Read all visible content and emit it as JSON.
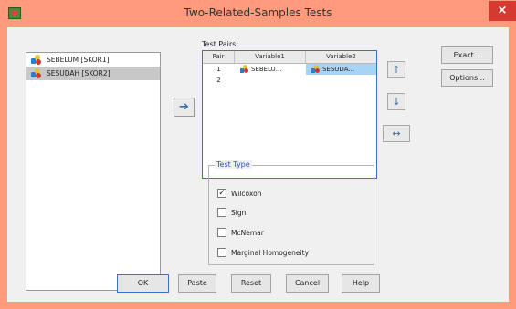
{
  "window": {
    "title": "Two-Related-Samples Tests",
    "close_glyph": "×",
    "icon": "spss-dialog-icon"
  },
  "variables": [
    {
      "label": "SEBELUM [SKOR1]",
      "icon": "scale-variable-icon",
      "selected": false
    },
    {
      "label": "SESUDAH [SKOR2]",
      "icon": "scale-variable-icon",
      "selected": true
    }
  ],
  "move_button": {
    "glyph": "➔",
    "icon": "arrow-right-icon"
  },
  "test_pairs": {
    "label": "Test Pairs:",
    "columns": [
      "Pair",
      "Variable1",
      "Variable2"
    ],
    "rows": [
      {
        "pair": "1",
        "variable1": "SEBELU...",
        "variable2": "SESUDA..."
      },
      {
        "pair": "2",
        "variable1": "",
        "variable2": ""
      }
    ]
  },
  "side_buttons": {
    "up": "↑",
    "down": "↓",
    "swap": "↔"
  },
  "right_buttons": {
    "exact": "Exact...",
    "options": "Options..."
  },
  "test_type": {
    "legend": "Test Type",
    "options": [
      {
        "label": "Wilcoxon",
        "checked": true
      },
      {
        "label": "Sign",
        "checked": false
      },
      {
        "label": "McNemar",
        "checked": false
      },
      {
        "label": "Marginal Homogeneity",
        "checked": false
      }
    ]
  },
  "bottom_buttons": {
    "ok": "OK",
    "paste": "Paste",
    "reset": "Reset",
    "cancel": "Cancel",
    "help": "Help"
  },
  "colors": {
    "titlebar": "#ff9b7c",
    "close_button": "#d43a2f",
    "selection": "#a9d3f5",
    "focus_border": "#3a6fd8"
  }
}
